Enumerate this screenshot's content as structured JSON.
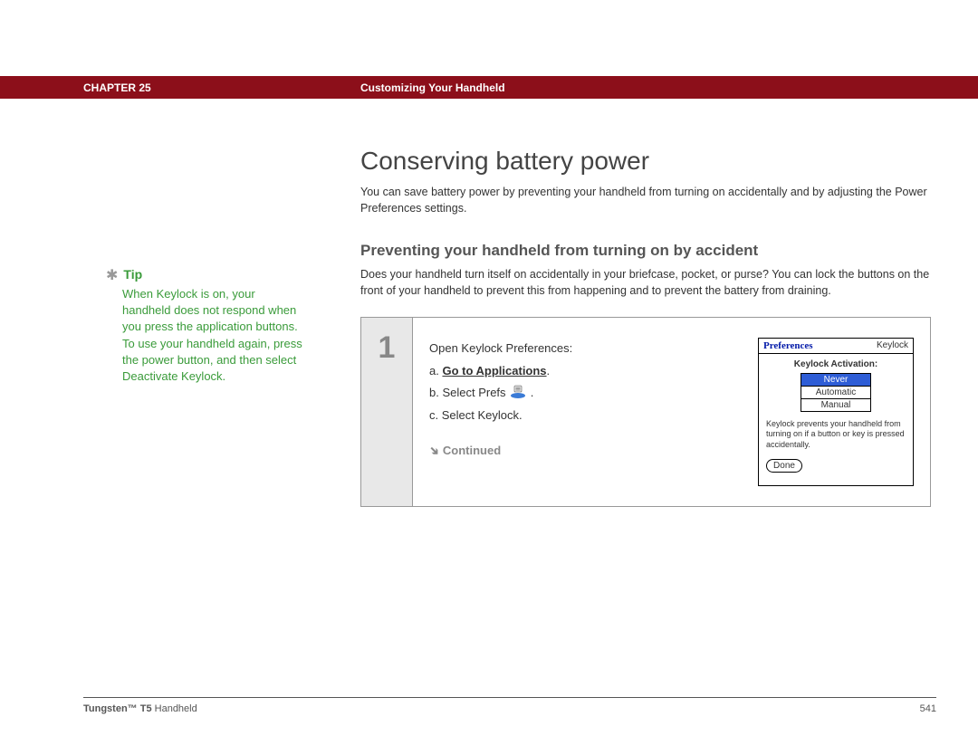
{
  "header": {
    "chapter": "CHAPTER 25",
    "title": "Customizing Your Handheld"
  },
  "sidebar": {
    "tip_label": "Tip",
    "tip_body": "When Keylock is on, your handheld does not respond when you press the application buttons. To use your handheld again, press the power button, and then select Deactivate Keylock."
  },
  "main": {
    "h1": "Conserving battery power",
    "intro": "You can save battery power by preventing your handheld from turning on accidentally and by adjusting the Power Preferences settings.",
    "h2": "Preventing your handheld from turning on by accident",
    "body": "Does your handheld turn itself on accidentally in your briefcase, pocket, or purse? You can lock the buttons on the front of your handheld to prevent this from happening and to prevent the battery from draining.",
    "step_num": "1",
    "instr_intro": "Open Keylock Preferences:",
    "step_a_prefix": "a.  ",
    "step_a_link": "Go to Applications",
    "step_a_suffix": ".",
    "step_b_prefix": "b.  Select Prefs ",
    "step_b_suffix": " .",
    "step_c": "c.  Select Keylock.",
    "continued": "Continued"
  },
  "screenshot": {
    "pref_label": "Preferences",
    "section_label": "Keylock",
    "subtitle": "Keylock Activation:",
    "opt1": "Never",
    "opt2": "Automatic",
    "opt3": "Manual",
    "desc": "Keylock prevents your handheld from turning on if a button or key is pressed accidentally.",
    "done": "Done"
  },
  "footer": {
    "product_bold": "Tungsten™ T5",
    "product_rest": " Handheld",
    "page": "541"
  }
}
